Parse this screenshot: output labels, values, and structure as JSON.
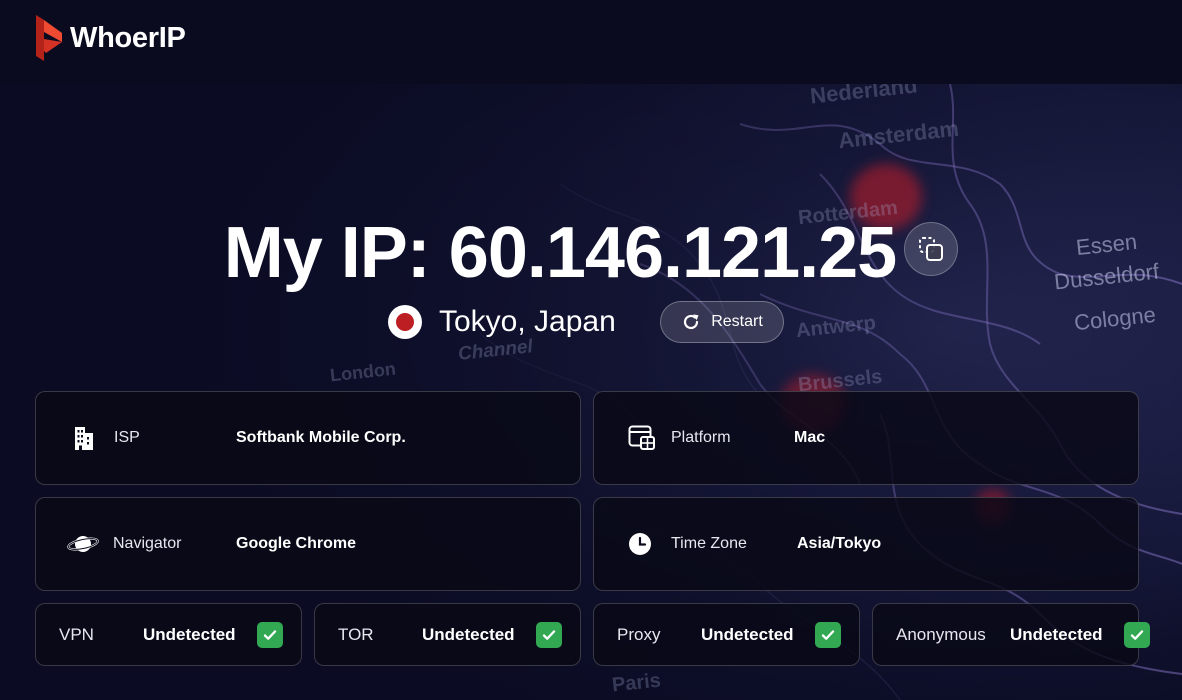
{
  "brand": {
    "name": "WhoerIP"
  },
  "hero": {
    "title": "My IP: 60.146.121.25",
    "location": "Tokyo, Japan",
    "restart_label": "Restart"
  },
  "map_labels": [
    "Amsterdam",
    "Rotterdam",
    "Essen",
    "Dusseldorf",
    "Cologne",
    "Antwerp",
    "Brussels",
    "Channel",
    "Paris",
    "London",
    "Nederland"
  ],
  "info_cards": [
    {
      "label": "ISP",
      "value": "Softbank Mobile Corp.",
      "icon": "building-icon"
    },
    {
      "label": "Platform",
      "value": "Mac",
      "icon": "platform-icon"
    },
    {
      "label": "Navigator",
      "value": "Google Chrome",
      "icon": "planet-icon"
    },
    {
      "label": "Time Zone",
      "value": "Asia/Tokyo",
      "icon": "clock-icon"
    }
  ],
  "status_cards": [
    {
      "label": "VPN",
      "value": "Undetected"
    },
    {
      "label": "TOR",
      "value": "Undetected"
    },
    {
      "label": "Proxy",
      "value": "Undetected"
    },
    {
      "label": "Anonymous",
      "value": "Undetected"
    }
  ],
  "colors": {
    "background": "#0b0c24",
    "header": "#0a0b1f",
    "accent_red": "#e23a2c",
    "flag_red": "#bc1e23",
    "check_green": "#32a852"
  }
}
